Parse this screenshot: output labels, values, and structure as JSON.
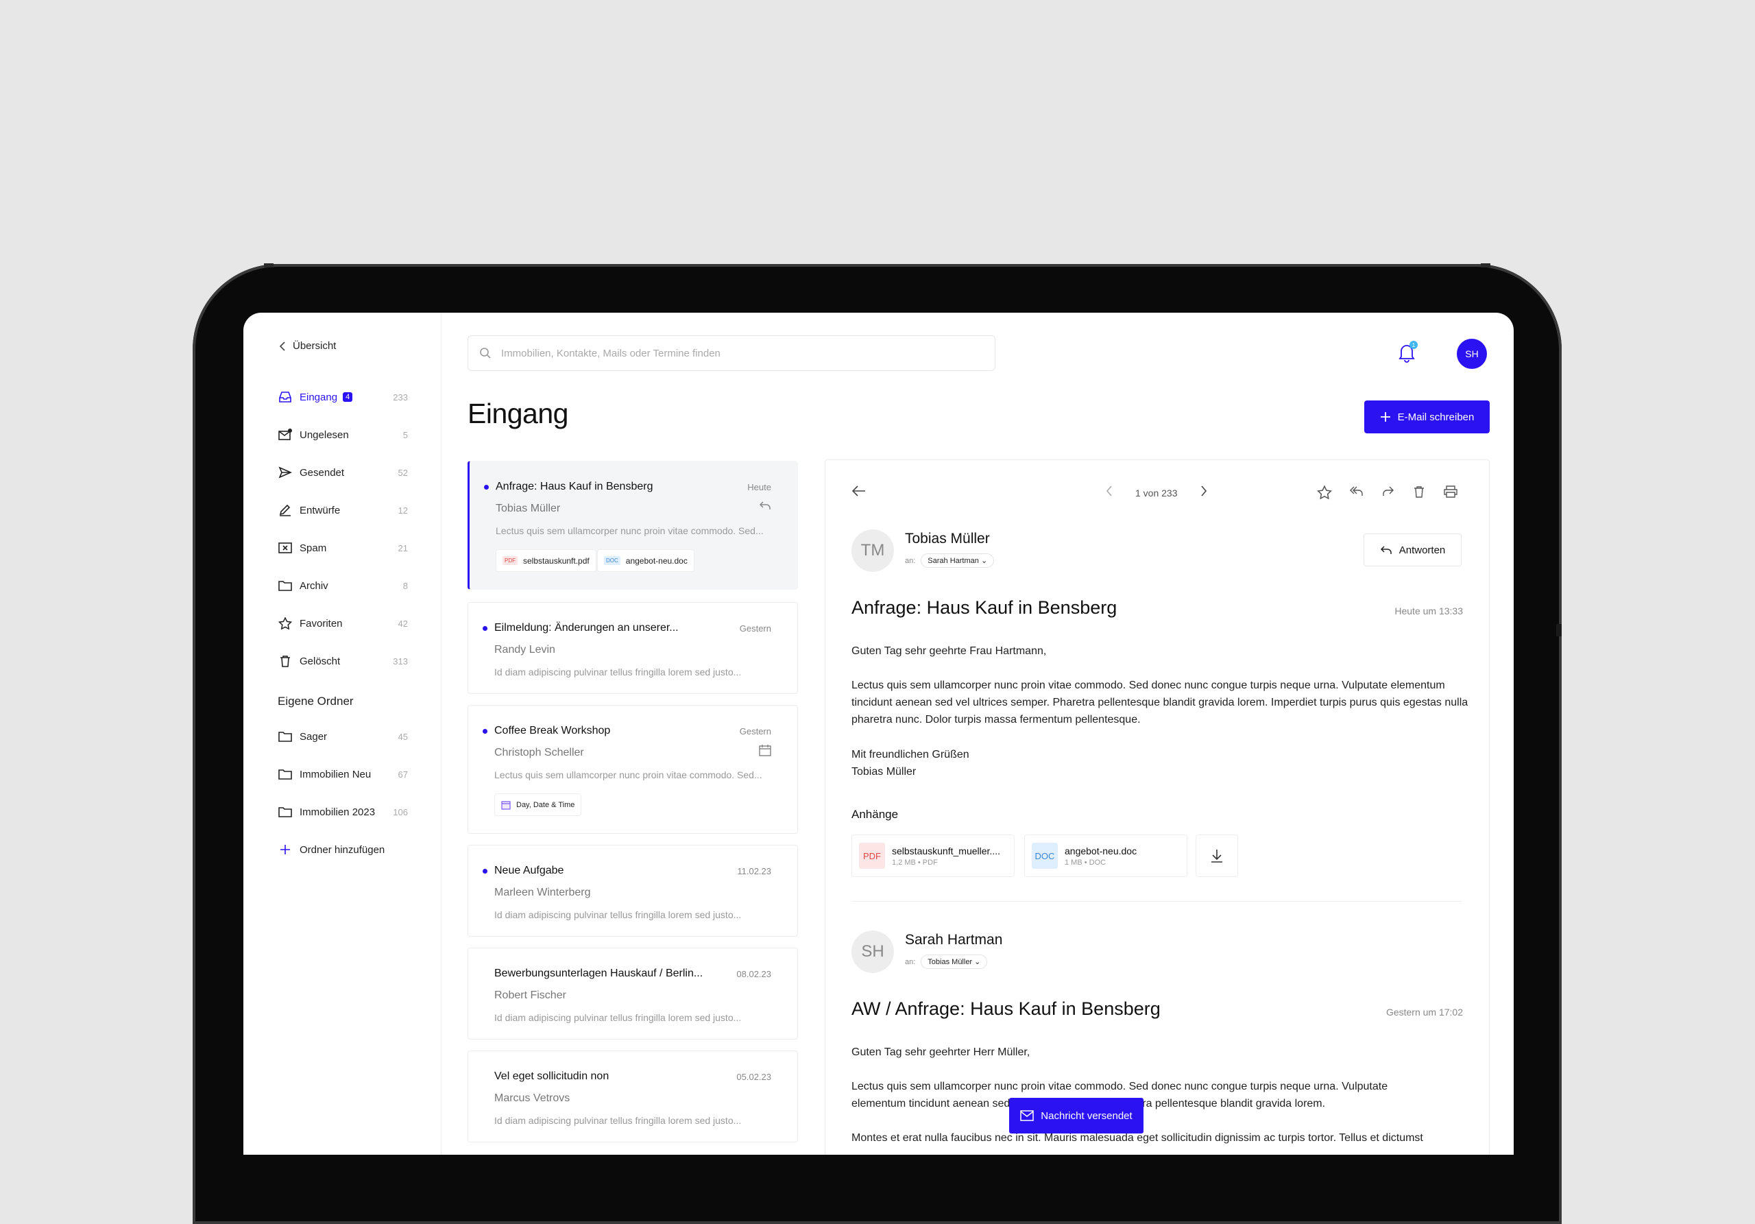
{
  "sidebar": {
    "back_label": "Übersicht",
    "items": [
      {
        "label": "Eingang",
        "badge": "4",
        "count": "233"
      },
      {
        "label": "Ungelesen",
        "count": "5"
      },
      {
        "label": "Gesendet",
        "count": "52"
      },
      {
        "label": "Entwürfe",
        "count": "12"
      },
      {
        "label": "Spam",
        "count": "21"
      },
      {
        "label": "Archiv",
        "count": "8"
      },
      {
        "label": "Favoriten",
        "count": "42"
      },
      {
        "label": "Gelöscht",
        "count": "313"
      }
    ],
    "own_folders_title": "Eigene Ordner",
    "folders": [
      {
        "label": "Sager",
        "count": "45"
      },
      {
        "label": "Immobilien Neu",
        "count": "67"
      },
      {
        "label": "Immobilien 2023",
        "count": "106"
      }
    ],
    "add_folder_label": "Ordner hinzufügen"
  },
  "header": {
    "search_placeholder": "Immobilien, Kontakte, Mails oder Termine finden",
    "notification_count": "1",
    "user_initials": "SH"
  },
  "page": {
    "title": "Eingang",
    "compose_label": "E-Mail schreiben"
  },
  "mails": [
    {
      "subject": "Anfrage: Haus Kauf in Bensberg",
      "date": "Heute",
      "from": "Tobias Müller",
      "preview": "Lectus quis sem ullamcorper nunc proin vitae commodo. Sed...",
      "attachments": [
        "selbstauskunft.pdf",
        "angebot-neu.doc"
      ]
    },
    {
      "subject": "Eilmeldung: Änderungen an unserer...",
      "date": "Gestern",
      "from": "Randy Levin",
      "preview": "Id diam adipiscing pulvinar tellus fringilla lorem sed justo..."
    },
    {
      "subject": "Coffee Break Workshop",
      "date": "Gestern",
      "from": "Christoph Scheller",
      "preview": "Lectus quis sem ullamcorper nunc proin vitae commodo. Sed...",
      "event_chip": "Day, Date & Time"
    },
    {
      "subject": "Neue Aufgabe",
      "date": "11.02.23",
      "from": "Marleen Winterberg",
      "preview": "Id diam adipiscing pulvinar tellus fringilla lorem sed justo..."
    },
    {
      "subject": "Bewerbungsunterlagen Hauskauf / Berlin...",
      "date": "08.02.23",
      "from": "Robert Fischer",
      "preview": "Id diam adipiscing pulvinar tellus fringilla lorem sed justo..."
    },
    {
      "subject": "Vel eget sollicitudin non",
      "date": "05.02.23",
      "from": "Marcus Vetrovs",
      "preview": "Id diam adipiscing pulvinar tellus fringilla lorem sed justo..."
    }
  ],
  "reader": {
    "pager": "1 von 233",
    "messages": [
      {
        "initials": "TM",
        "sender": "Tobias Müller",
        "to_label": "an:",
        "to": "Sarah Hartman",
        "reply_label": "Antworten",
        "subject": "Anfrage: Haus Kauf in Bensberg",
        "date": "Heute um 13:33",
        "greeting": "Guten Tag sehr geehrte Frau Hartmann,",
        "body": "Lectus quis sem ullamcorper nunc proin vitae commodo. Sed donec nunc congue turpis neque urna. Vulputate elementum tincidunt aenean sed vel ultrices semper. Pharetra pellentesque blandit gravida lorem. Imperdiet turpis purus quis egestas nulla pharetra nunc. Dolor turpis massa fermentum pellentesque.",
        "closing": "Mit freundlichen Grüßen",
        "signature": "Tobias Müller",
        "attachments_title": "Anhänge",
        "attachments": [
          {
            "type": "PDF",
            "name": "selbstauskunft_mueller....",
            "meta": "1,2 MB • PDF"
          },
          {
            "type": "DOC",
            "name": "angebot-neu.doc",
            "meta": "1 MB • DOC"
          }
        ]
      },
      {
        "initials": "SH",
        "sender": "Sarah Hartman",
        "to_label": "an:",
        "to": "Tobias Müller",
        "subject": "AW / Anfrage: Haus Kauf in Bensberg",
        "date": "Gestern um 17:02",
        "greeting": "Guten Tag sehr geehrter Herr Müller,",
        "body_line1": "Lectus quis sem ullamcorper nunc proin vitae commodo. Sed donec nunc congue turpis neque urna. Vulputate",
        "body_line2": "elementum tincidunt aenean sed vel ultrices semper. Pharetra pellentesque blandit gravida lorem.",
        "body_line3": "Montes et erat nulla faucibus nec in sit. Mauris malesuada eget sollicitudin dignissim ac turpis tortor. Tellus et dictumst"
      }
    ]
  },
  "toast": {
    "label": "Nachricht versendet"
  },
  "colors": {
    "accent": "#2b12f2",
    "background": "#e7e7e7",
    "device": "#0a0a0a"
  }
}
